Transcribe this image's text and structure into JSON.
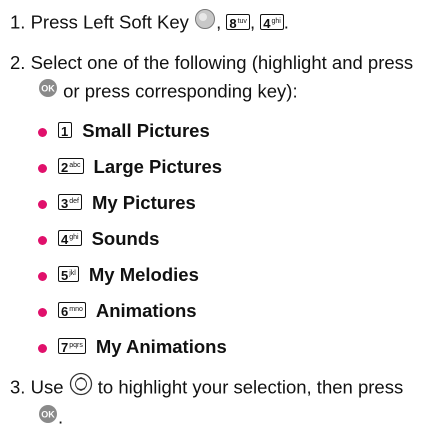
{
  "step1": {
    "number": "1.",
    "text": "Press Left Soft Key",
    "sep1": ",",
    "sep2": ",",
    "end": ".",
    "keys": [
      {
        "digit": "8",
        "sub": "tuv"
      },
      {
        "digit": "4",
        "sub": "ghi"
      }
    ],
    "icon": "left-soft-key-icon"
  },
  "step2": {
    "number": "2.",
    "line1": "Select one of the following (highlight and press",
    "line2": "or press corresponding key):",
    "icon": "ok-button-icon",
    "items": [
      {
        "digit": "1",
        "sub": "",
        "label": "Small Pictures"
      },
      {
        "digit": "2",
        "sub": "abc",
        "label": "Large Pictures"
      },
      {
        "digit": "3",
        "sub": "def",
        "label": "My Pictures"
      },
      {
        "digit": "4",
        "sub": "ghi",
        "label": "Sounds"
      },
      {
        "digit": "5",
        "sub": "jkl",
        "label": "My Melodies"
      },
      {
        "digit": "6",
        "sub": "mno",
        "label": "Animations"
      },
      {
        "digit": "7",
        "sub": "pqrs",
        "label": "My Animations"
      }
    ]
  },
  "step3": {
    "number": "3.",
    "line1a": "Use",
    "line1b": "to highlight your selection, then press",
    "line2": ".",
    "icons": [
      "navigation-key-icon",
      "ok-button-icon"
    ]
  },
  "colors": {
    "bullet": "#e0106b",
    "text": "#111111"
  }
}
